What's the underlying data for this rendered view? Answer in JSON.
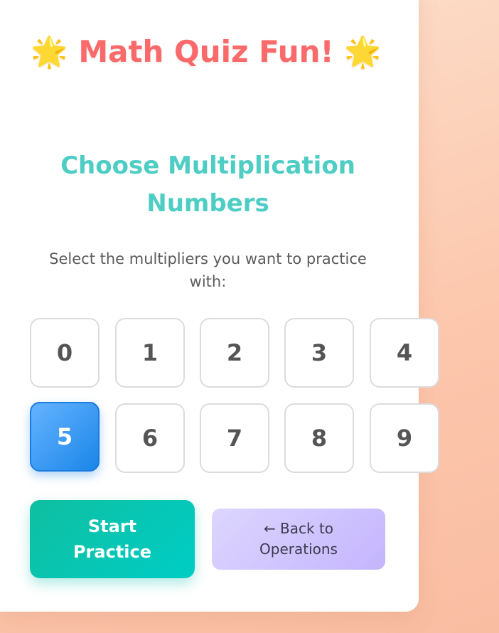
{
  "header": {
    "star_left": "🌟",
    "title": "Math Quiz Fun!",
    "star_right": "🌟"
  },
  "selection": {
    "heading": "Choose Multiplication Numbers",
    "instructions": "Select the multipliers you want to practice with:",
    "numbers": [
      "0",
      "1",
      "2",
      "3",
      "4",
      "5",
      "6",
      "7",
      "8",
      "9"
    ],
    "selected": [
      "5"
    ]
  },
  "actions": {
    "start_label": "Start Practice",
    "back_label": "← Back to Operations"
  },
  "colors": {
    "title": "#fb6a6a",
    "heading": "#4ecdc4",
    "selected": "#1a86e8",
    "start": "#00c2aa",
    "back": "#c4b5fd"
  }
}
